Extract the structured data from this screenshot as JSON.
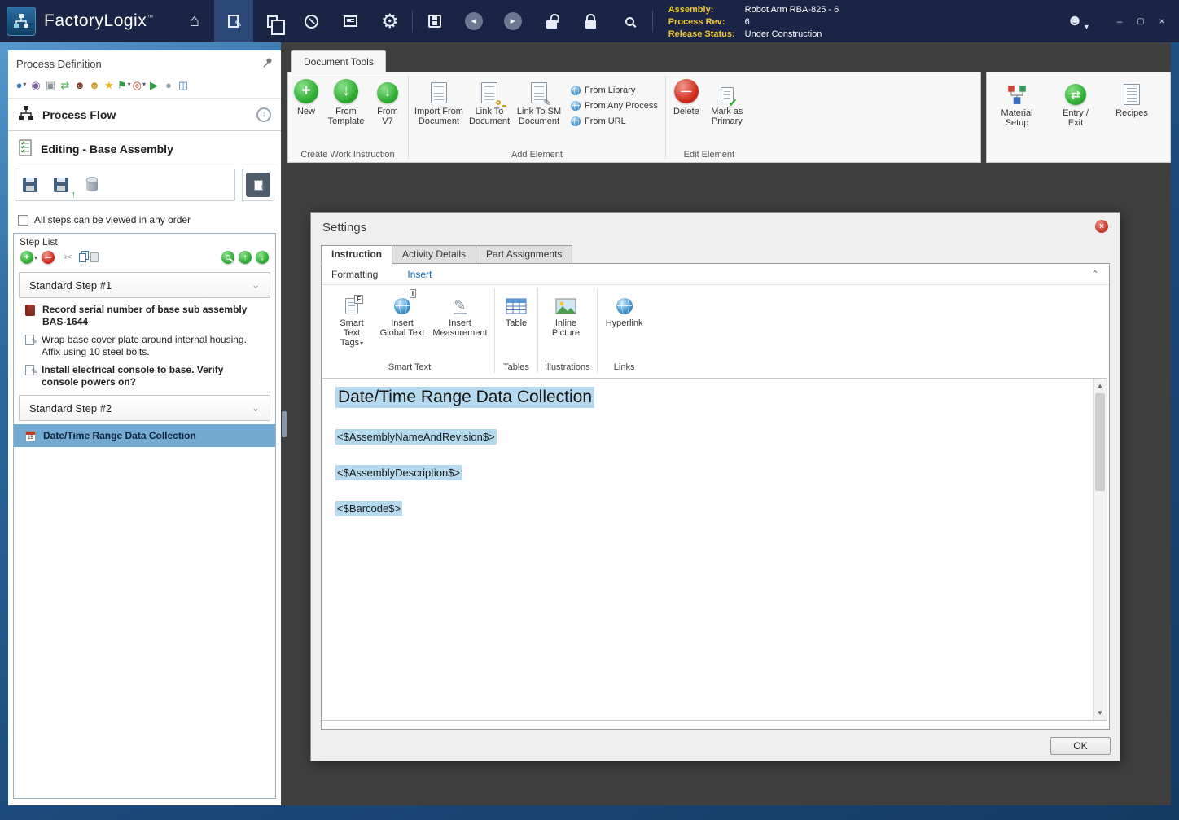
{
  "icons": {
    "home": "⌂",
    "gear": "⚙",
    "back": "◄",
    "forward": "►",
    "minimize": "–",
    "maximize": "▢",
    "close": "×",
    "dropdown": "▾",
    "chevron_down": "⌄",
    "chevron_up": "⌃",
    "plus": "+",
    "no_entry": "—",
    "swap": "⇄",
    "check": "✔",
    "scissors": "✂",
    "pencil": "✎",
    "up": "↑",
    "down": "↓",
    "star": "★",
    "flag": "⚑",
    "person": "☻",
    "sphere": "●",
    "target": "◎",
    "play": "▶",
    "record": "●",
    "printer": "▣",
    "orbit": "◉",
    "pause": "◫",
    "badge_f": "F",
    "badge_i": "I",
    "tm": "™"
  },
  "titlebar": {
    "app_name": "FactoryLogix",
    "assembly_label": "Assembly:",
    "assembly_value": "Robot Arm RBA-825 - 6",
    "process_rev_label": "Process Rev:",
    "process_rev_value": "6",
    "release_status_label": "Release Status:",
    "release_status_value": "Under Construction"
  },
  "left_panel": {
    "title": "Process Definition",
    "process_flow": "Process Flow",
    "editing": "Editing - Base Assembly",
    "order_checkbox": "All steps can be viewed in any order",
    "step_list_title": "Step List",
    "group1": "Standard Step #1",
    "group2": "Standard Step #2",
    "step1": "Record serial number of base sub assembly BAS-1644",
    "step2": "Wrap base cover plate around internal housing. Affix using 10 steel bolts.",
    "step3": "Install electrical console to base. Verify console powers on?",
    "selected_step": "Date/Time Range Data Collection"
  },
  "ribbon": {
    "tab": "Document Tools",
    "create": {
      "label": "Create Work Instruction",
      "new": "New",
      "from_template": "From Template",
      "from_v7": "From V7"
    },
    "add": {
      "label": "Add Element",
      "import_doc": "Import From Document",
      "link_doc": "Link To Document",
      "link_sm": "Link To SM Document",
      "from_library": "From Library",
      "from_any": "From Any Process",
      "from_url": "From URL"
    },
    "edit": {
      "label": "Edit Element",
      "delete": "Delete",
      "mark_primary": "Mark as Primary"
    },
    "right": {
      "material": "Material Setup",
      "entry_exit": "Entry / Exit",
      "recipes": "Recipes"
    }
  },
  "settings": {
    "title": "Settings",
    "tab_instruction": "Instruction",
    "tab_activity": "Activity Details",
    "tab_parts": "Part Assignments",
    "rt_formatting": "Formatting",
    "rt_insert": "Insert",
    "btn_smart_tags": "Smart Text Tags",
    "btn_global_text": "Insert Global Text",
    "btn_measurement": "Insert Measurement",
    "btn_table": "Table",
    "btn_picture": "Inline Picture",
    "btn_hyperlink": "Hyperlink",
    "grp_smart": "Smart Text",
    "grp_tables": "Tables",
    "grp_illustrations": "Illustrations",
    "grp_links": "Links",
    "doc_heading": "Date/Time Range Data Collection",
    "token1": "<$AssemblyNameAndRevision$>",
    "token2": "<$AssemblyDescription$>",
    "token3": "<$Barcode$>",
    "ok": "OK"
  }
}
